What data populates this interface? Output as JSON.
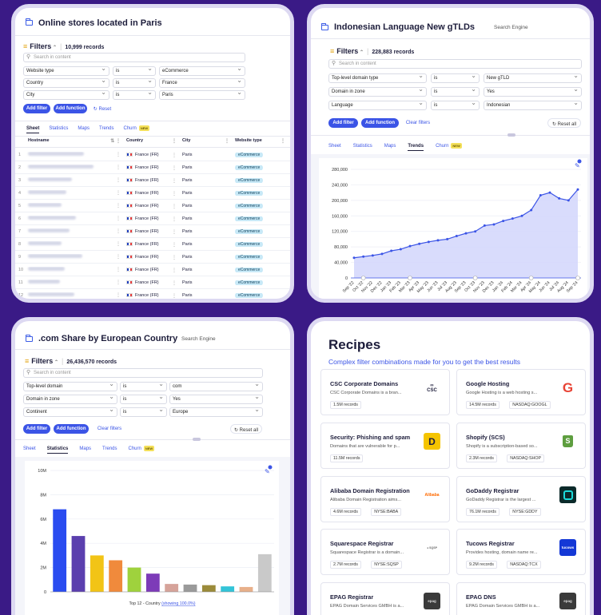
{
  "paris": {
    "title": "Online stores located in Paris",
    "filters_label": "Filters",
    "records": "10,999 records",
    "search_placeholder": "Search in content",
    "filters": [
      {
        "field": "Website type",
        "op": "is",
        "value": "eCommerce"
      },
      {
        "field": "Country",
        "op": "is",
        "value": "France"
      },
      {
        "field": "City",
        "op": "is",
        "value": "Paris"
      }
    ],
    "add_filter": "Add filter",
    "add_function": "Add function",
    "reset": "Reset",
    "tabs": [
      "Sheet",
      "Statistics",
      "Maps",
      "Trends",
      "Churn"
    ],
    "new_badge": "NEW",
    "columns": [
      "Hostname",
      "Country",
      "City",
      "Website type"
    ],
    "rows": [
      {
        "n": "1",
        "country": "France (FR)",
        "city": "Paris",
        "type": "eCommerce"
      },
      {
        "n": "2",
        "country": "France (FR)",
        "city": "Paris",
        "type": "eCommerce"
      },
      {
        "n": "3",
        "country": "France (FR)",
        "city": "Paris",
        "type": "eCommerce"
      },
      {
        "n": "4",
        "country": "France (FR)",
        "city": "Paris",
        "type": "eCommerce"
      },
      {
        "n": "5",
        "country": "France (FR)",
        "city": "Paris",
        "type": "eCommerce"
      },
      {
        "n": "6",
        "country": "France (FR)",
        "city": "Paris",
        "type": "eCommerce"
      },
      {
        "n": "7",
        "country": "France (FR)",
        "city": "Paris",
        "type": "eCommerce"
      },
      {
        "n": "8",
        "country": "France (FR)",
        "city": "Paris",
        "type": "eCommerce"
      },
      {
        "n": "9",
        "country": "France (FR)",
        "city": "Paris",
        "type": "eCommerce"
      },
      {
        "n": "10",
        "country": "France (FR)",
        "city": "Paris",
        "type": "eCommerce"
      },
      {
        "n": "11",
        "country": "France (FR)",
        "city": "Paris",
        "type": "eCommerce"
      },
      {
        "n": "12",
        "country": "France (FR)",
        "city": "Paris",
        "type": "eCommerce"
      }
    ]
  },
  "indonesian": {
    "title": "Indonesian Language New gTLDs",
    "engine": "Search Engine",
    "filters_label": "Filters",
    "records": "228,883 records",
    "search_placeholder": "Search in content",
    "filters": [
      {
        "field": "Top-level domain type",
        "op": "is",
        "value": "New gTLD"
      },
      {
        "field": "Domain in zone",
        "op": "is",
        "value": "Yes"
      },
      {
        "field": "Language",
        "op": "is",
        "value": "Indonesian"
      }
    ],
    "add_filter": "Add filter",
    "add_function": "Add function",
    "clear": "Clear filters",
    "reset": "Reset all",
    "tabs": [
      "Sheet",
      "Statistics",
      "Maps",
      "Trends",
      "Churn"
    ],
    "new_badge": "NEW"
  },
  "com_share": {
    "title": ".com Share by European Country",
    "engine": "Search Engine",
    "filters_label": "Filters",
    "records": "26,436,570 records",
    "search_placeholder": "Search in content",
    "filters": [
      {
        "field": "Top-level domain",
        "op": "is",
        "value": "com"
      },
      {
        "field": "Domain in zone",
        "op": "is",
        "value": "Yes"
      },
      {
        "field": "Continent",
        "op": "is",
        "value": "Europe"
      }
    ],
    "add_filter": "Add filter",
    "add_function": "Add function",
    "clear": "Clear filters",
    "reset": "Reset all",
    "tabs": [
      "Sheet",
      "Statistics",
      "Maps",
      "Trends",
      "Churn"
    ],
    "new_badge": "NEW",
    "caption": "Top 12 - Country",
    "caption_link": "(showing 100.0%)"
  },
  "recipes": {
    "title": "Recipes",
    "subtitle": "Complex filter combinations made for you to get the best results",
    "cards": [
      {
        "name": "CSC Corporate Domains",
        "desc": "CSC Corporate Domains is a bran...",
        "records": "1.5M records",
        "tag": "",
        "logo": "CSC",
        "color": "#ffffff"
      },
      {
        "name": "Google Hosting",
        "desc": "Google Hosting is a web hosting s...",
        "records": "14.5M records",
        "tag": "NASDAQ:GOOGL",
        "logo": "G",
        "color": "#ffffff"
      },
      {
        "name": "Security: Phishing and spam",
        "desc": "Domains that are vulnerable for p...",
        "records": "11.5M records",
        "tag": "",
        "logo": "D",
        "color": "#f5c400"
      },
      {
        "name": "Shopify (SCS)",
        "desc": "Shopify is a subscription-based so...",
        "records": "2.3M records",
        "tag": "NASDAQ:SHOP",
        "logo": "S",
        "color": "#ffffff"
      },
      {
        "name": "Alibaba Domain Registration",
        "desc": "Alibaba Domain Registration aims...",
        "records": "4.6M records",
        "tag": "NYSE:BABA",
        "logo": "Alibaba",
        "color": "#ffffff"
      },
      {
        "name": "GoDaddy Registrar",
        "desc": "GoDaddy Registrar is the largest ...",
        "records": "76.1M records",
        "tag": "NYSE:GDDY",
        "logo": "GD",
        "color": "#0b2a2a"
      },
      {
        "name": "Squarespace Registrar",
        "desc": "Squarespace Registrar is a domain...",
        "records": "2.7M records",
        "tag": "NYSE:SQSP",
        "logo": "SQSP",
        "color": "#ffffff"
      },
      {
        "name": "Tucows Registrar",
        "desc": "Provides hosting, domain name re...",
        "records": "9.2M records",
        "tag": "NASDAQ:TCX",
        "logo": "tucows",
        "color": "#1438d6"
      },
      {
        "name": "EPAG Registrar",
        "desc": "EPAG Domain Services GMBH is a...",
        "records": "",
        "tag": "",
        "logo": "epag",
        "color": "#3a3a3a"
      },
      {
        "name": "EPAG DNS",
        "desc": "EPAG Domain Services GMBH is a...",
        "records": "",
        "tag": "",
        "logo": "epag",
        "color": "#3a3a3a"
      }
    ]
  },
  "chart_data": [
    {
      "type": "area",
      "x": [
        "Sep '22",
        "Oct '22",
        "Nov '22",
        "Dec '22",
        "Jan '23",
        "Feb '23",
        "Mar '23",
        "Apr '23",
        "May '23",
        "Jun '23",
        "Jul '23",
        "Aug '23",
        "Sep '23",
        "Oct '23",
        "Nov '23",
        "Dec '23",
        "Jan '24",
        "Feb '24",
        "Mar '24",
        "Apr '24",
        "May '24",
        "Jun '24",
        "Jul '24",
        "Aug '24",
        "Sep '24"
      ],
      "values": [
        52000,
        55000,
        58000,
        62000,
        70000,
        74000,
        82000,
        88000,
        93000,
        97000,
        100000,
        108000,
        115000,
        120000,
        135000,
        138000,
        147000,
        153000,
        160000,
        175000,
        213000,
        220000,
        205000,
        200000,
        228000
      ],
      "ylim": [
        0,
        280000
      ],
      "yticks": [
        "0",
        "40,000",
        "80,000",
        "120,000",
        "160,000",
        "200,000",
        "240,000",
        "280,000"
      ],
      "xlabel": "",
      "ylabel": "",
      "grid": true
    },
    {
      "type": "bar",
      "values": [
        6800000,
        4600000,
        3000000,
        2600000,
        2000000,
        1500000,
        650000,
        600000,
        550000,
        450000,
        400000,
        3100000
      ],
      "colors": [
        "#2a4cf0",
        "#5b3fae",
        "#f2c416",
        "#f08a3c",
        "#9fd23d",
        "#7d3bb8",
        "#d6a39a",
        "#9a9a9a",
        "#9b8b3a",
        "#33c4d8",
        "#e8b08a",
        "#c9c9c9"
      ],
      "ylim": [
        0,
        10000000
      ],
      "yticks": [
        "0",
        "2M",
        "4M",
        "6M",
        "8M",
        "10M"
      ],
      "xlabel": "Top 12 - Country (showing 100.0%)",
      "ylabel": "",
      "grid": true
    }
  ]
}
